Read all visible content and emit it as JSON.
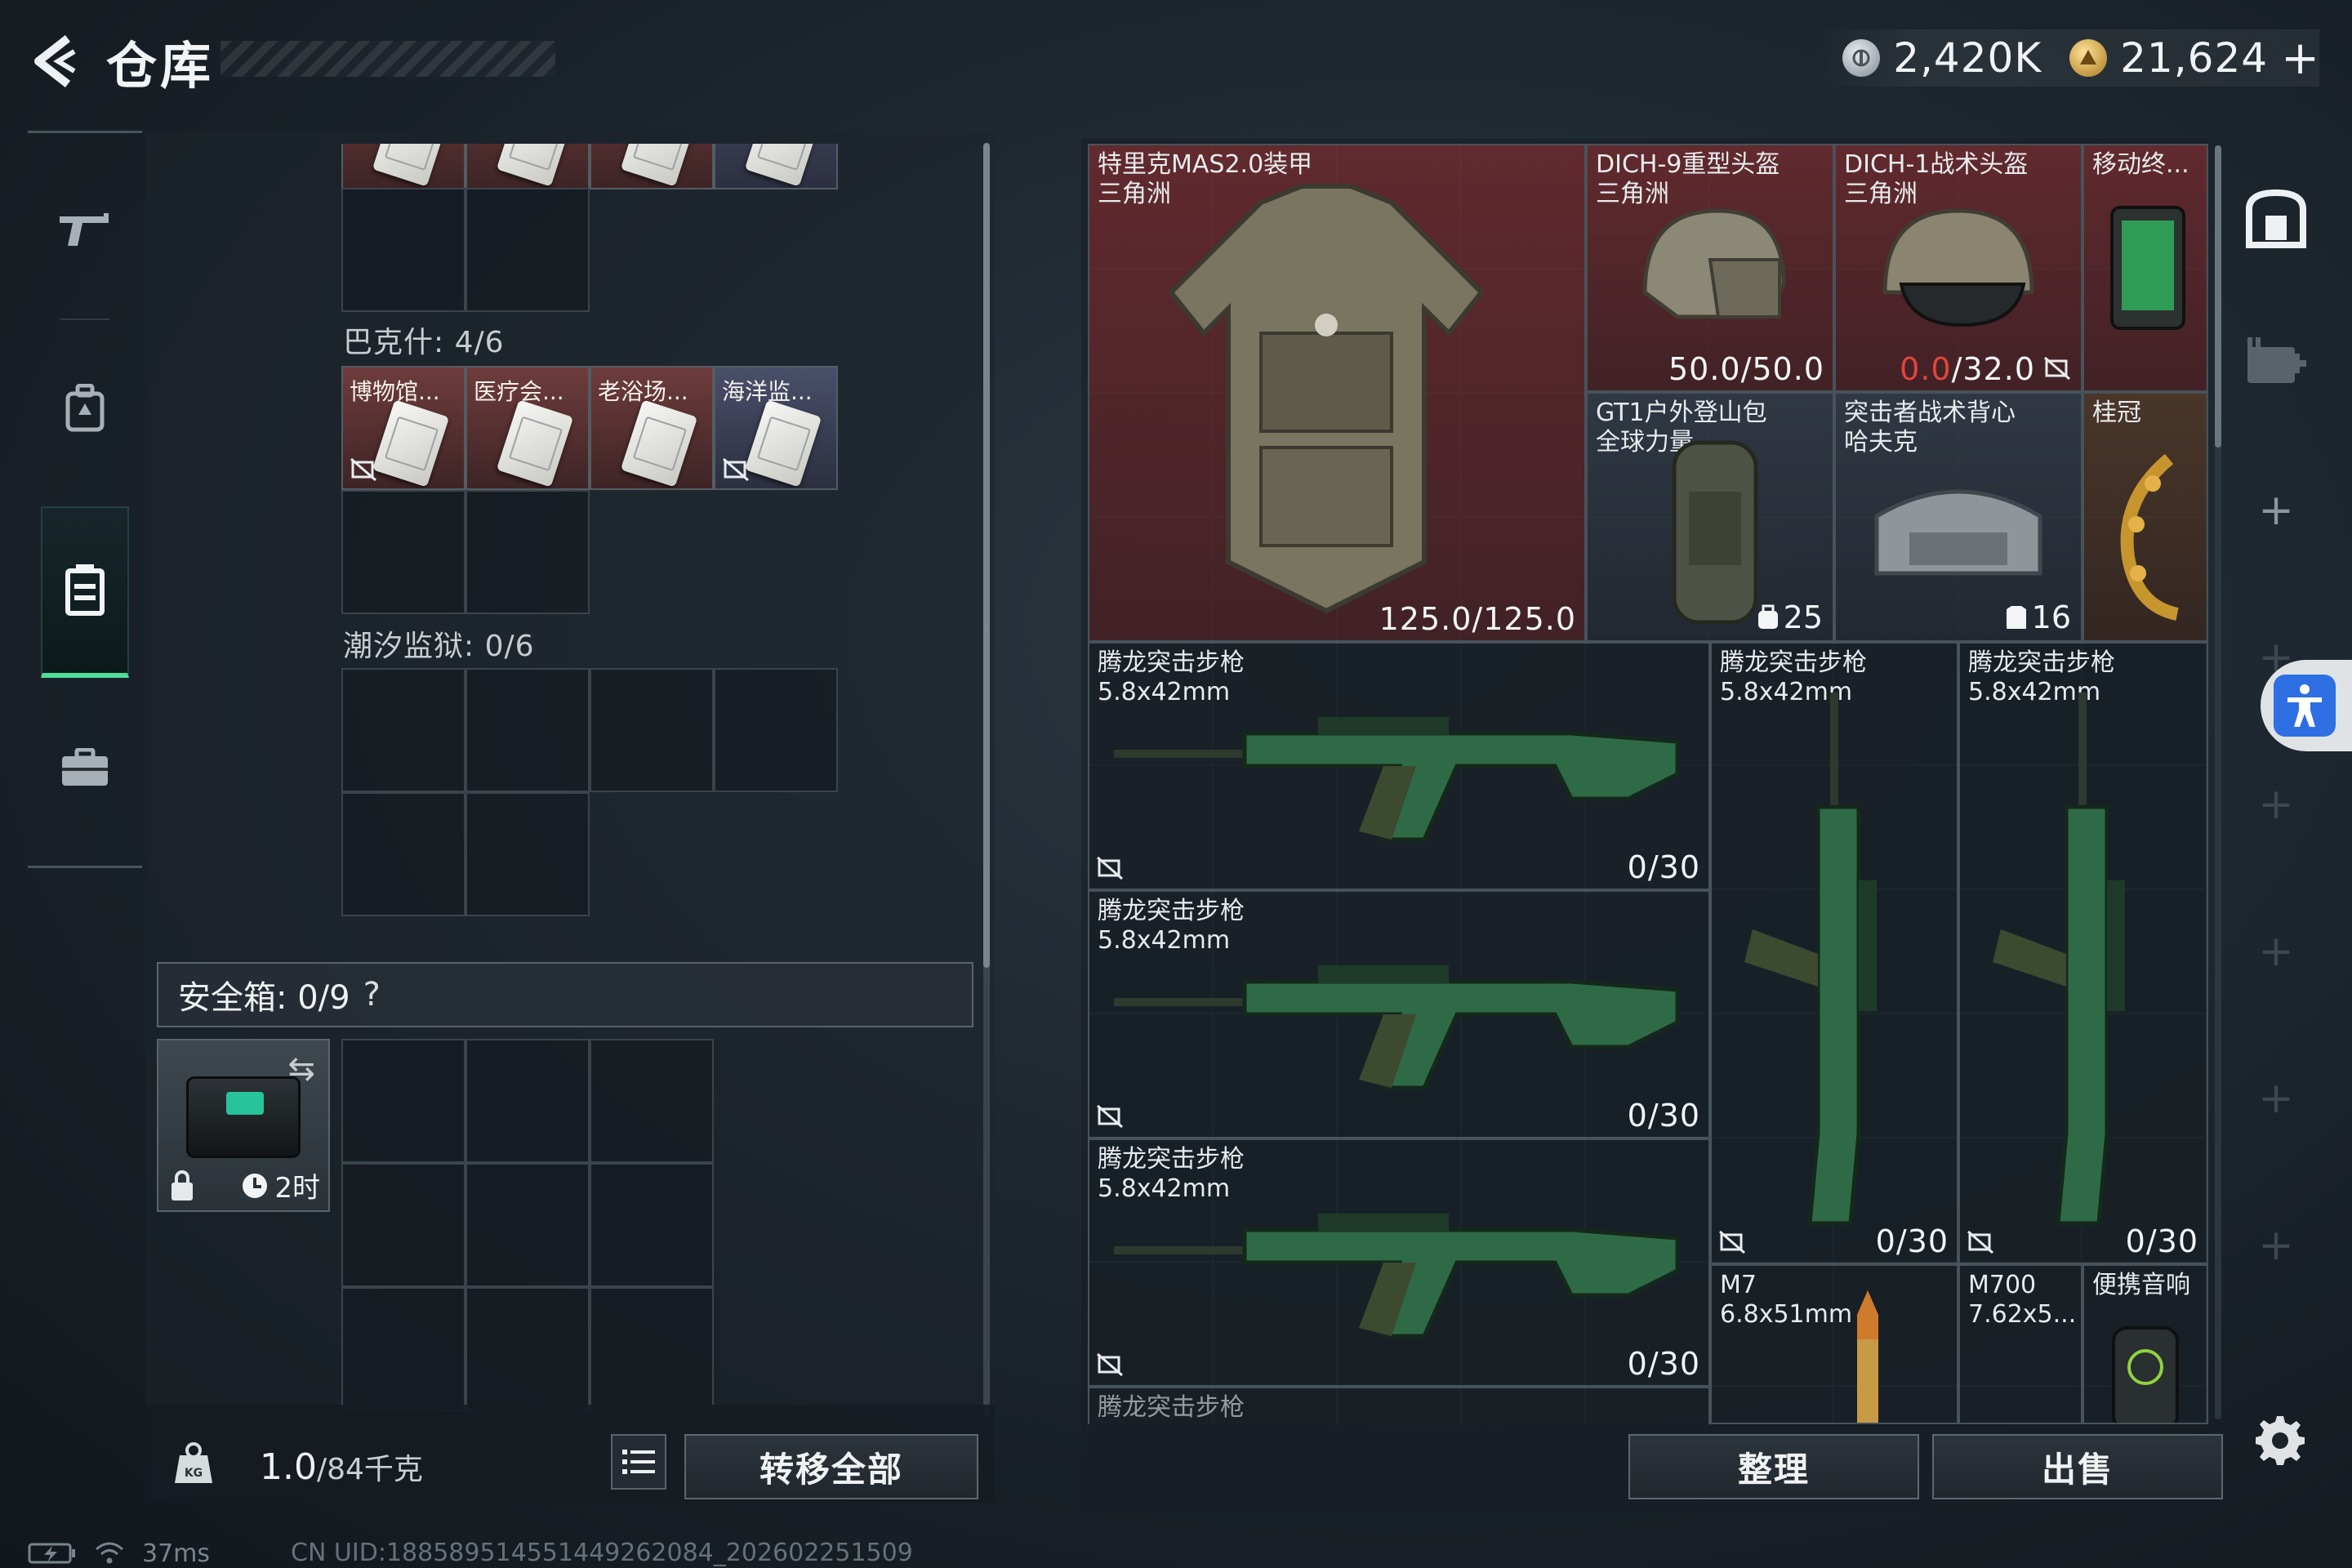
{
  "header": {
    "title": "仓库",
    "currency_silver": "2,420K",
    "currency_gold": "21,624",
    "add_label": "+"
  },
  "left_nav": {
    "items": [
      {
        "icon": "gun-icon",
        "active": false
      },
      {
        "icon": "backpack-icon",
        "active": false
      },
      {
        "icon": "storage-case-icon",
        "active": true
      },
      {
        "icon": "briefcase-icon",
        "active": false
      }
    ]
  },
  "stash": {
    "sections": [
      {
        "label": "巴克什: 4/6"
      },
      {
        "label": "潮汐监狱: 0/6"
      }
    ],
    "bakshi_items": [
      {
        "name": "博物馆...",
        "color": "red"
      },
      {
        "name": "医疗会...",
        "color": "red"
      },
      {
        "name": "老浴场...",
        "color": "red"
      },
      {
        "name": "海洋监...",
        "color": "blue"
      }
    ],
    "safe_box": {
      "label": "安全箱: 0/9",
      "help": "?",
      "timer": "2时"
    },
    "weight": {
      "current": "1.0",
      "capacity": "/84千克"
    },
    "transfer_all": "转移全部"
  },
  "inventory": {
    "items": [
      {
        "id": "armor",
        "name": "特里克MAS2.0装甲",
        "sub": "三角洲",
        "value": "125.0/125.0"
      },
      {
        "id": "helmet1",
        "name": "DICH-9重型头盔",
        "sub": "三角洲",
        "value": "50.0/50.0"
      },
      {
        "id": "helmet2",
        "name": "DICH-1战术头盔",
        "sub": "三角洲",
        "value_red": "0.0",
        "value_rest": "/32.0"
      },
      {
        "id": "terminal",
        "name": "移动终..."
      },
      {
        "id": "backpack",
        "name": "GT1户外登山包",
        "sub": "全球力量",
        "count": "25"
      },
      {
        "id": "vest",
        "name": "突击者战术背心",
        "sub": "哈夫克",
        "count": "16"
      },
      {
        "id": "crown",
        "name": "桂冠"
      },
      {
        "id": "rifle1",
        "name": "腾龙突击步枪",
        "sub": "5.8x42mm",
        "ammo": "0/30"
      },
      {
        "id": "rifle2",
        "name": "腾龙突击步枪",
        "sub": "5.8x42mm",
        "ammo": "0/30"
      },
      {
        "id": "rifle3",
        "name": "腾龙突击步枪",
        "sub": "5.8x42mm",
        "ammo": "0/30"
      },
      {
        "id": "rifle4",
        "name": "腾龙突击步枪",
        "sub": "5.8x42mm",
        "ammo": "0/30"
      },
      {
        "id": "rifle5",
        "name": "腾龙突击步枪",
        "sub": "5.8x42mm",
        "ammo": "0/30"
      },
      {
        "id": "m7",
        "name": "M7",
        "sub": "6.8x51mm"
      },
      {
        "id": "m700",
        "name": "M700",
        "sub": "7.62x5..."
      },
      {
        "id": "speaker",
        "name": "便携音响"
      },
      {
        "id": "rifle6",
        "name": "腾龙突击步枪"
      }
    ],
    "tidy": "整理",
    "sell": "出售"
  },
  "status": {
    "ping": "37ms",
    "uid": "CN UID:18858951455144926208​4_202602251509"
  },
  "colors": {
    "accent_green": "#4fdc9a",
    "item_red": "#6e2c30",
    "warning_red": "#e2443a",
    "accessibility_blue": "#2e6fe3"
  }
}
